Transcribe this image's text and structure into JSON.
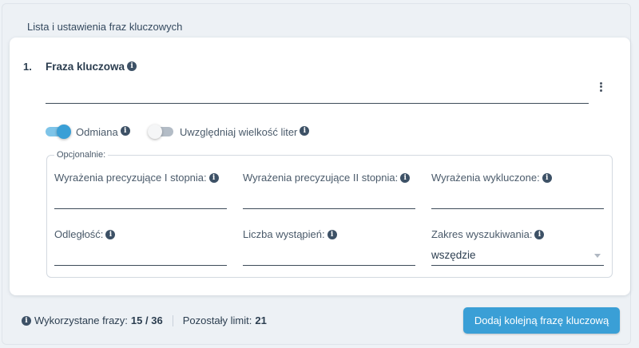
{
  "panel": {
    "title": "Lista i ustawienia fraz kluczowych"
  },
  "phrase": {
    "number": "1.",
    "label": "Fraza kluczowa",
    "value": "",
    "toggles": [
      {
        "label": "Odmiana",
        "state": "on"
      },
      {
        "label": "Uwzględniaj wielkość liter",
        "state": "off"
      }
    ],
    "optional": {
      "legend": "Opcjonalnie:",
      "fields": {
        "refine1": {
          "label": "Wyrażenia precyzujące I stopnia:",
          "value": ""
        },
        "refine2": {
          "label": "Wyrażenia precyzujące II stopnia:",
          "value": ""
        },
        "excluded": {
          "label": "Wyrażenia wykluczone:",
          "value": ""
        },
        "distance": {
          "label": "Odległość:",
          "value": ""
        },
        "occurrences": {
          "label": "Liczba wystąpień:",
          "value": ""
        },
        "scope": {
          "label": "Zakres wyszukiwania:",
          "value": "wszędzie"
        }
      }
    }
  },
  "footer": {
    "used_label": "Wykorzystane frazy:",
    "used_value": "15 / 36",
    "limit_label": "Pozostały limit:",
    "limit_value": "21",
    "add_button": "Dodaj kolejną frazę kluczową"
  },
  "icons": {
    "info": "info-icon",
    "menu": "kebab-menu-icon",
    "dropdown": "chevron-down-icon"
  },
  "colors": {
    "accent": "#3a9fd6",
    "toggle_on_track": "#7ec4e8",
    "icon_dark": "#3d5166"
  }
}
